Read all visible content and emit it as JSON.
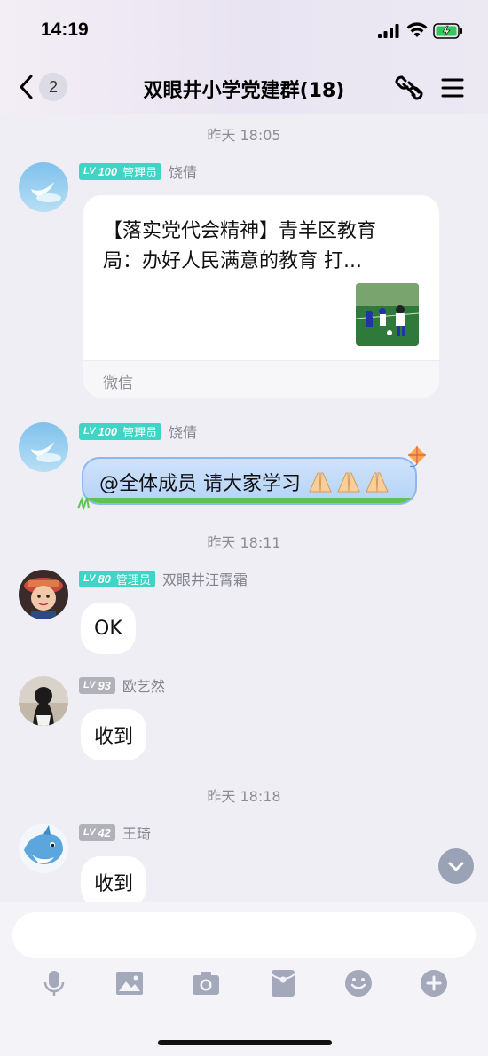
{
  "status_bar": {
    "time": "14:19"
  },
  "nav": {
    "back_count": "2",
    "title": "双眼井小学党建群(18)"
  },
  "messages": {
    "ts1": "昨天 18:05",
    "m1": {
      "level": "100",
      "role": "管理员",
      "sender": "饶倩",
      "card_title": "【落实党代会精神】青羊区教育局：办好人民满意的教育 打...",
      "card_source": "微信"
    },
    "m2": {
      "level": "100",
      "role": "管理员",
      "sender": "饶倩",
      "text": "@全体成员  请大家学习"
    },
    "ts2": "昨天 18:11",
    "m3": {
      "level": "80",
      "role": "管理员",
      "sender": "双眼井汪霄霜",
      "text": "OK"
    },
    "m4": {
      "level": "93",
      "sender": "欧艺然",
      "text": "收到"
    },
    "ts3": "昨天 18:18",
    "m5": {
      "level": "42",
      "sender": "王琦",
      "text": "收到"
    }
  },
  "lv_word": "LV",
  "input": {
    "placeholder": ""
  },
  "colors": {
    "teal_badge": "#3fd4c6",
    "grey_badge": "#b1b1ba",
    "background": "#eeeef4",
    "icon": "#a3a9bb"
  },
  "icons": [
    "back-chevron",
    "link-icon",
    "menu-icon",
    "chevron-down-icon",
    "microphone-icon",
    "image-icon",
    "camera-icon",
    "red-packet-icon",
    "emoji-icon",
    "plus-icon"
  ]
}
